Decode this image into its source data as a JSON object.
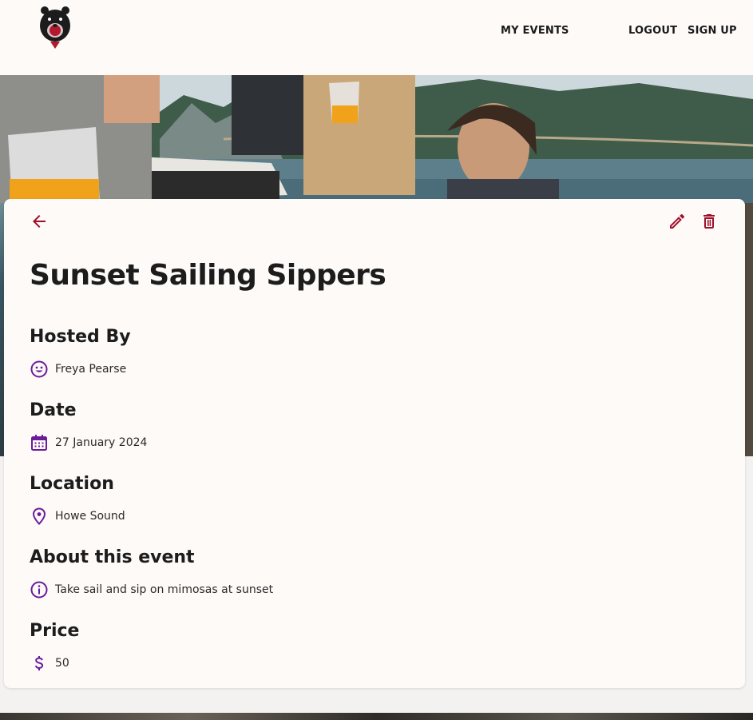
{
  "nav": {
    "my_events": "MY EVENTS",
    "logout": "LOGOUT",
    "sign_up": "SIGN UP"
  },
  "event": {
    "title": "Sunset Sailing Sippers",
    "sections": {
      "host": {
        "heading": "Hosted By",
        "value": "Freya Pearse",
        "icon": "smiley-icon"
      },
      "date": {
        "heading": "Date",
        "value": "27 January 2024",
        "icon": "calendar-icon"
      },
      "location": {
        "heading": "Location",
        "value": "Howe Sound",
        "icon": "location-pin-icon"
      },
      "about": {
        "heading": "About this event",
        "value": "Take sail and sip on mimosas at sunset",
        "icon": "info-icon"
      },
      "price": {
        "heading": "Price",
        "value": "50",
        "icon": "dollar-icon"
      }
    }
  },
  "colors": {
    "accent_red": "#a0102a",
    "icon_purple": "#6a1b9a",
    "card_bg": "#fdfaf8"
  }
}
